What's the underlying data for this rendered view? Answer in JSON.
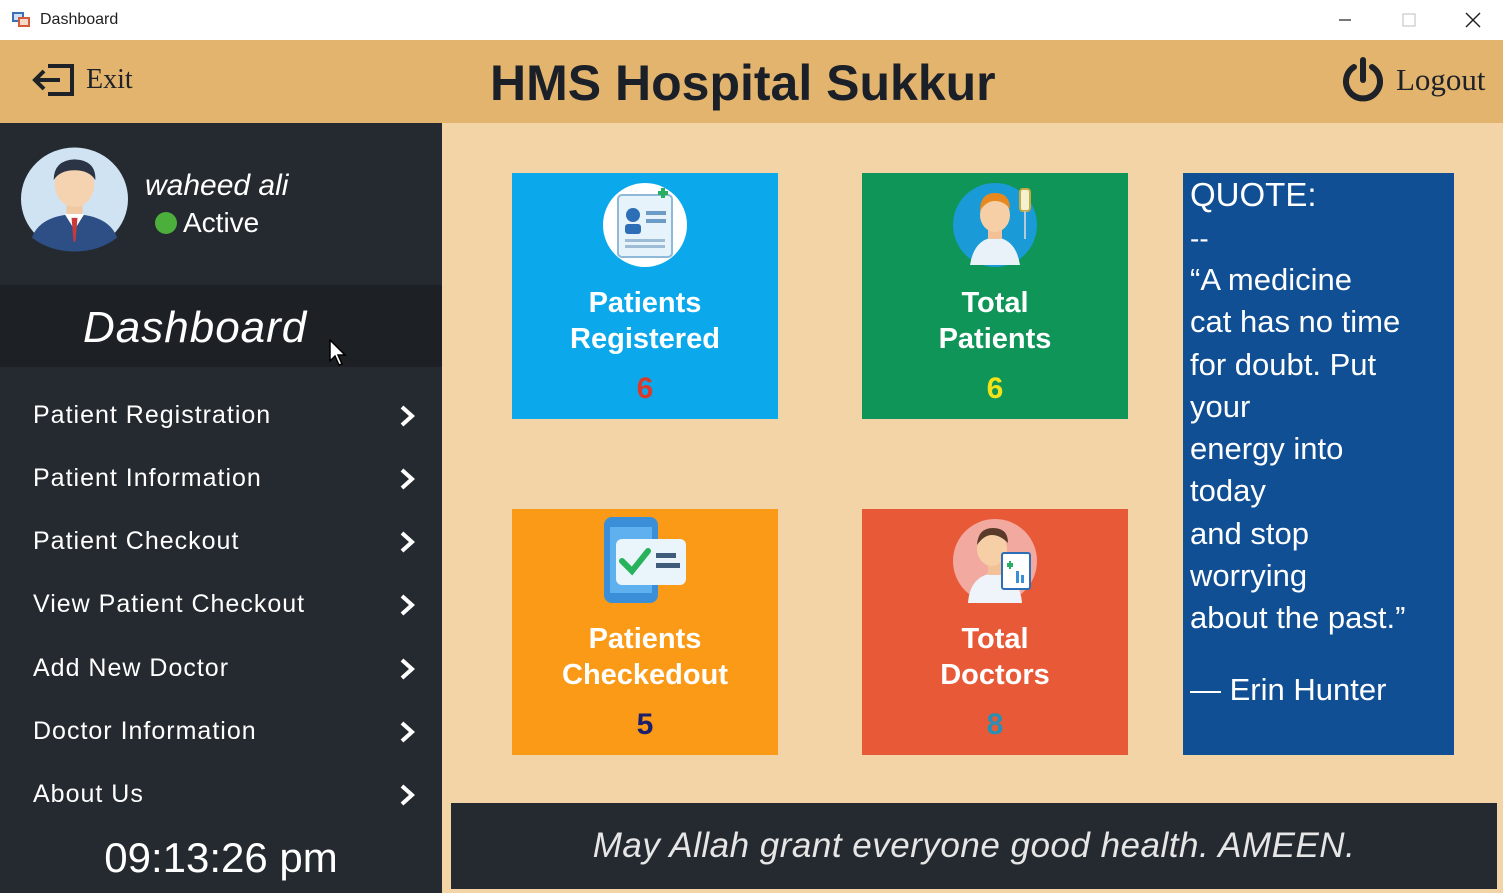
{
  "window": {
    "title": "Dashboard",
    "icon": "app-window-icon",
    "controls": [
      "minimize-icon",
      "maximize-icon",
      "close-icon"
    ]
  },
  "header": {
    "exit_label": "Exit",
    "exit_icon": "exit-door-arrow-icon",
    "title": "HMS Hospital Sukkur",
    "logout_label": "Logout",
    "logout_icon": "power-icon",
    "background": "#e2b46d"
  },
  "profile": {
    "name": "waheed ali",
    "status": "Active",
    "status_color": "#4caf3c",
    "avatar_icon": "user-avatar-icon"
  },
  "sidebar": {
    "active_item": "Dashboard",
    "items": [
      {
        "label": "Patient Registration",
        "icon": "chevron-right-icon"
      },
      {
        "label": "Patient Information",
        "icon": "chevron-right-icon"
      },
      {
        "label": "Patient Checkout",
        "icon": "chevron-right-icon"
      },
      {
        "label": "View Patient Checkout",
        "icon": "chevron-right-icon"
      },
      {
        "label": "Add New Doctor",
        "icon": "chevron-right-icon"
      },
      {
        "label": "Doctor Information",
        "icon": "chevron-right-icon"
      },
      {
        "label": "About Us",
        "icon": "chevron-right-icon"
      }
    ],
    "clock": "09:13:26 pm",
    "background": "#252a30"
  },
  "cards": [
    {
      "title_line1": "Patients",
      "title_line2": "Registered",
      "count": "6",
      "color": "#0ba9ec",
      "count_color": "#d93a2b",
      "icon": "patient-record-icon"
    },
    {
      "title_line1": "Total",
      "title_line2": "Patients",
      "count": "6",
      "color": "#0f9557",
      "count_color": "#f2e21a",
      "icon": "patient-iv-icon"
    },
    {
      "title_line1": "Patients",
      "title_line2": "Checkedout",
      "count": "5",
      "color": "#fb9a16",
      "count_color": "#1c1f6b",
      "icon": "checklist-phone-icon"
    },
    {
      "title_line1": "Total",
      "title_line2": "Doctors",
      "count": "8",
      "color": "#e85a37",
      "count_color": "#2a8fb5",
      "icon": "doctor-icon"
    }
  ],
  "quote": {
    "heading": "QUOTE:",
    "dashes": "--",
    "lines": [
      "“A medicine",
      "cat has no time",
      "for doubt. Put",
      "your",
      "energy into",
      "today",
      "and stop",
      "worrying",
      "about the past.”"
    ],
    "author": "— Erin Hunter",
    "background": "#114f94"
  },
  "footer": {
    "text": "May Allah grant everyone good health. AMEEN."
  }
}
